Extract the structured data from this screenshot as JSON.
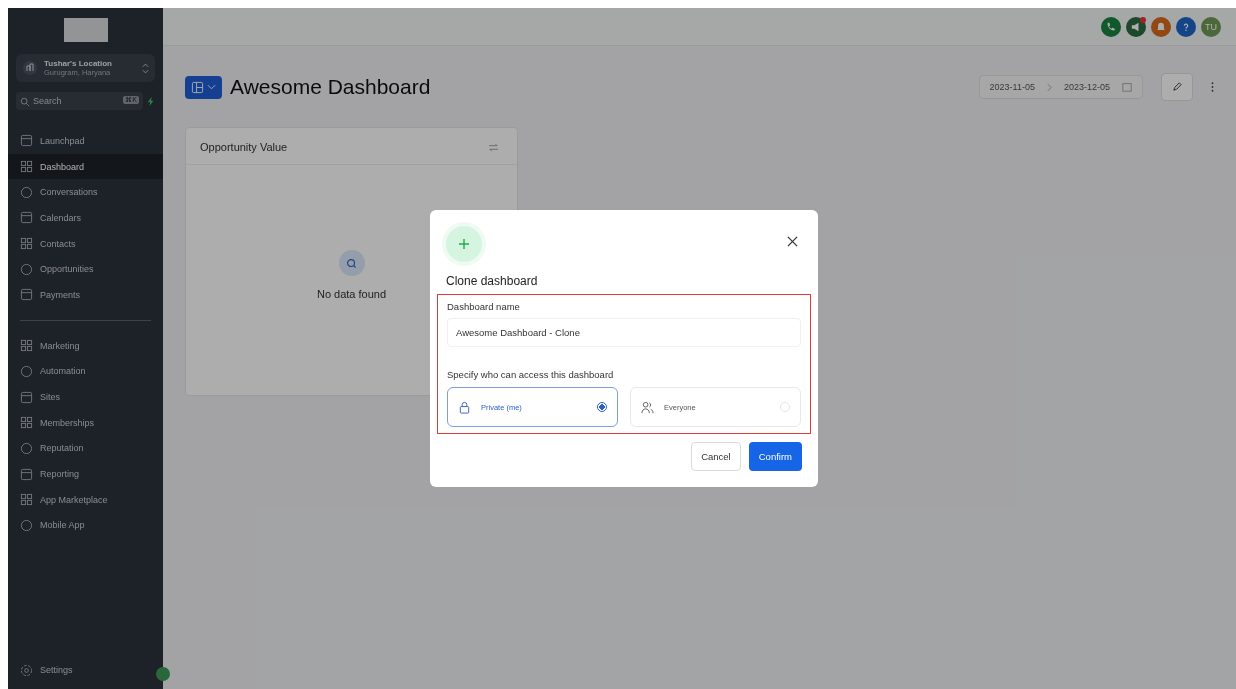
{
  "sidebar": {
    "location": {
      "name": "Tushar's Location",
      "place": "Gurugram, Haryana"
    },
    "search": {
      "placeholder": "Search",
      "shortcut": "⌘K"
    },
    "nav_groups": [
      [
        {
          "label": "Launchpad",
          "selected": false
        },
        {
          "label": "Dashboard",
          "selected": true
        },
        {
          "label": "Conversations",
          "selected": false
        },
        {
          "label": "Calendars",
          "selected": false
        },
        {
          "label": "Contacts",
          "selected": false
        },
        {
          "label": "Opportunities",
          "selected": false
        },
        {
          "label": "Payments",
          "selected": false
        }
      ],
      [
        {
          "label": "Marketing",
          "selected": false
        },
        {
          "label": "Automation",
          "selected": false
        },
        {
          "label": "Sites",
          "selected": false
        },
        {
          "label": "Memberships",
          "selected": false
        },
        {
          "label": "Reputation",
          "selected": false
        },
        {
          "label": "Reporting",
          "selected": false
        },
        {
          "label": "App Marketplace",
          "selected": false
        },
        {
          "label": "Mobile App",
          "selected": false
        }
      ]
    ],
    "settings": "Settings"
  },
  "top_bar": {
    "avatar": "TU"
  },
  "header": {
    "title": "Awesome Dashboard",
    "date_from": "2023-11-05",
    "date_to": "2023-12-05"
  },
  "widget": {
    "title": "Opportunity Value",
    "empty_text": "No data found"
  },
  "dialog": {
    "title": "Clone dashboard",
    "name_label": "Dashboard name",
    "name_value": "Awesome Dashboard - Clone",
    "access_label": "Specify who can access this dashboard",
    "options": [
      {
        "label": "Private (me)",
        "selected": true
      },
      {
        "label": "Everyone",
        "selected": false
      }
    ],
    "cancel": "Cancel",
    "confirm": "Confirm"
  }
}
